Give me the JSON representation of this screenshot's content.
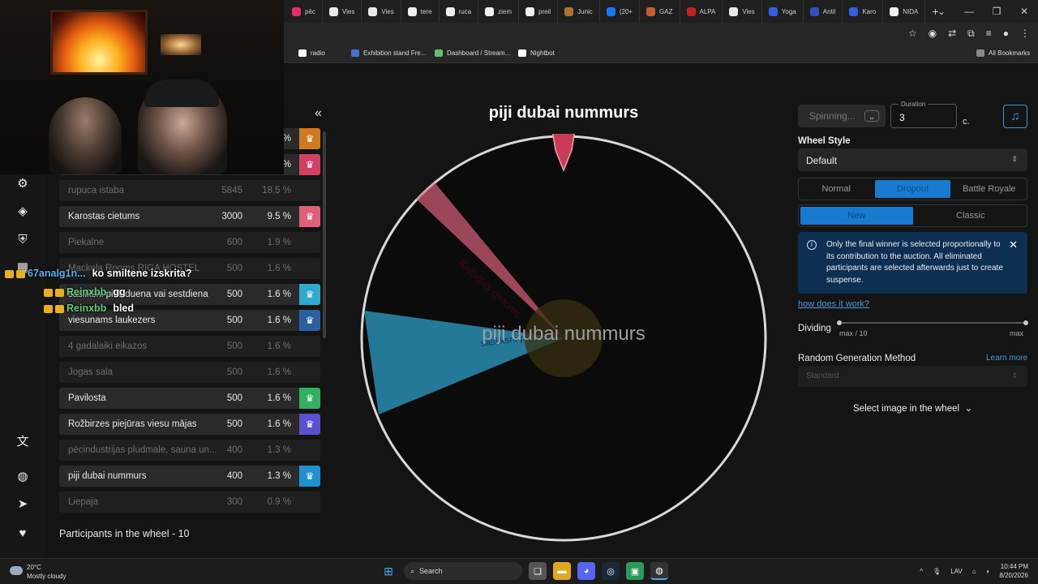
{
  "browser": {
    "tabs": [
      {
        "label": "pēc",
        "color": "#e0306a"
      },
      {
        "label": "Vies",
        "color": "#e8e8e8"
      },
      {
        "label": "Vies",
        "color": "#e8e8e8"
      },
      {
        "label": "tere",
        "color": "#f0f0f0"
      },
      {
        "label": "ruca",
        "color": "#f0f0f0"
      },
      {
        "label": "ziem",
        "color": "#f0f0f0"
      },
      {
        "label": "preil",
        "color": "#f0f0f0"
      },
      {
        "label": "Junic",
        "color": "#b07030"
      },
      {
        "label": "(20+",
        "color": "#1877f2"
      },
      {
        "label": "GAZ",
        "color": "#c06030"
      },
      {
        "label": "ALPA",
        "color": "#c02020"
      },
      {
        "label": "Vies",
        "color": "#e8e8e8"
      },
      {
        "label": "Yoga",
        "color": "#3060e0"
      },
      {
        "label": "Antil",
        "color": "#3050c0"
      },
      {
        "label": "Karo",
        "color": "#3060e0"
      },
      {
        "label": "NIDA",
        "color": "#f0f0f0"
      }
    ],
    "bookmarks": [
      {
        "label": "radio",
        "color": "#ffffff"
      },
      {
        "label": "Exhibition stand Fre...",
        "color": "#4a70d0"
      },
      {
        "label": "Dashboard / Stream...",
        "color": "#60c070"
      },
      {
        "label": "Nightbot",
        "color": "#ffffff"
      },
      {
        "label": "All Bookmarks",
        "color": "#888888"
      }
    ]
  },
  "sidebar": {
    "collapse_icon": "«",
    "participants_footer": "Participants in the wheel - 10"
  },
  "participants": [
    {
      "name": "",
      "amount": "",
      "percent": "%",
      "eliminated": false,
      "color": "#d07a20"
    },
    {
      "name": "",
      "amount": "",
      "percent": "%",
      "eliminated": false,
      "color": "#d04060"
    },
    {
      "name": "rupuca istaba",
      "amount": "5845",
      "percent": "18.5 %",
      "eliminated": true,
      "color": ""
    },
    {
      "name": "Karostas cietums",
      "amount": "3000",
      "percent": "9.5 %",
      "eliminated": false,
      "color": "#e0607a"
    },
    {
      "name": "Piekalne",
      "amount": "600",
      "percent": "1.9 %",
      "eliminated": true,
      "color": ""
    },
    {
      "name": "Mackela Rooms RIGA HOSTEL",
      "amount": "500",
      "percent": "1.6 %",
      "eliminated": true,
      "color": ""
    },
    {
      "name": "sasliksni pieklduena vai sestdiena",
      "amount": "500",
      "percent": "1.6 %",
      "eliminated": false,
      "color": "#30a8d0"
    },
    {
      "name": "viesunams laukezers",
      "amount": "500",
      "percent": "1.6 %",
      "eliminated": false,
      "color": "#2a60a0"
    },
    {
      "name": "4 gadalaiki eikazos",
      "amount": "500",
      "percent": "1.6 %",
      "eliminated": true,
      "color": ""
    },
    {
      "name": "Jogas sala",
      "amount": "500",
      "percent": "1.6 %",
      "eliminated": true,
      "color": ""
    },
    {
      "name": "Pavilosta",
      "amount": "500",
      "percent": "1.6 %",
      "eliminated": false,
      "color": "#30b060"
    },
    {
      "name": "Rožbirzes piejūras viesu mājas",
      "amount": "500",
      "percent": "1.6 %",
      "eliminated": false,
      "color": "#5a50d0"
    },
    {
      "name": "pēcindustrijas pludmale, sauna un...",
      "amount": "400",
      "percent": "1.3 %",
      "eliminated": true,
      "color": ""
    },
    {
      "name": "piji dubai nummurs",
      "amount": "400",
      "percent": "1.3 %",
      "eliminated": false,
      "color": "#2090d0"
    },
    {
      "name": "Liepaja",
      "amount": "300",
      "percent": "0.9 %",
      "eliminated": true,
      "color": ""
    }
  ],
  "chat": [
    {
      "user": "67analg1n...",
      "message": "ko smiltene izskrita?",
      "user_color": "#5ab0f0"
    },
    {
      "user": "Reinxbb",
      "message": "gg",
      "user_color": "#60d080"
    },
    {
      "user": "Reinxbb",
      "message": "bled",
      "user_color": "#60d080"
    }
  ],
  "wheel": {
    "title": "piji dubai nummurs",
    "center_text": "piji dubai nummurs",
    "segments": [
      {
        "label": "Karostas cietums",
        "color": "#e0607a"
      },
      {
        "label": "sasliksni pieklduen...",
        "color": "#30a8d0"
      }
    ]
  },
  "controls": {
    "spin_label": "Spinning...",
    "spin_key": "␣",
    "duration_label": "Duration",
    "duration_value": "3",
    "duration_unit": "c.",
    "music_icon": "♫",
    "wheel_style_label": "Wheel Style",
    "wheel_style_value": "Default",
    "modes": [
      "Normal",
      "Dropout",
      "Battle Royale"
    ],
    "active_mode": "Dropout",
    "variants": [
      "New",
      "Classic"
    ],
    "active_variant": "New",
    "info_text": "Only the final winner is selected proportionally to its contribution to the auction. All eliminated participants are selected afterwards just to create suspense.",
    "how_link": "how does it work?",
    "dividing_label": "Dividing",
    "dividing_min": "max / 10",
    "dividing_max": "max",
    "rng_label": "Random Generation Method",
    "rng_learn": "Learn more",
    "rng_value": "Standard",
    "image_select": "Select image in the wheel"
  },
  "taskbar": {
    "temperature": "20°C",
    "weather": "Mostly cloudy",
    "search": "Search",
    "lang": "LAV",
    "time": "10:44 PM",
    "date": "8/20/2026"
  }
}
